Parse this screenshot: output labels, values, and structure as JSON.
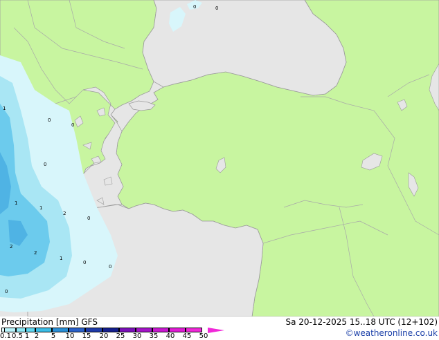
{
  "map": {
    "colors": {
      "land": "#c8f5a0",
      "sea": "#e6e6e6",
      "coast": "#9a9a9a",
      "border": "#a8a8a8",
      "precip_light": "#d8f6fb",
      "precip_mid": "#a9e6f4",
      "precip_heavy": "#6ccbed",
      "precip_max": "#4fb3e4"
    },
    "point_labels": [
      "0",
      "0",
      "1",
      "0",
      "0",
      "0",
      "1",
      "1",
      "2",
      "0",
      "2",
      "2",
      "1",
      "0",
      "0",
      "0"
    ]
  },
  "footer": {
    "title": "Precipitation [mm] GFS",
    "valid_time": "Sa 20-12-2025 15..18 UTC (12+102)",
    "credit": "©weatheronline.co.uk"
  },
  "legend": {
    "ticks": [
      "0.1",
      "0.5",
      "1",
      "2",
      "5",
      "10",
      "15",
      "20",
      "25",
      "30",
      "35",
      "40",
      "45",
      "50"
    ],
    "colors": [
      "#e0fbfd",
      "#b8f3fa",
      "#8ee8f5",
      "#5fd6ef",
      "#3bbde6",
      "#2a8fd6",
      "#2a60c8",
      "#1e3aa8",
      "#141e8c",
      "#7a10b8",
      "#a414c8",
      "#c818d0",
      "#e01cd4",
      "#f028d8"
    ]
  }
}
